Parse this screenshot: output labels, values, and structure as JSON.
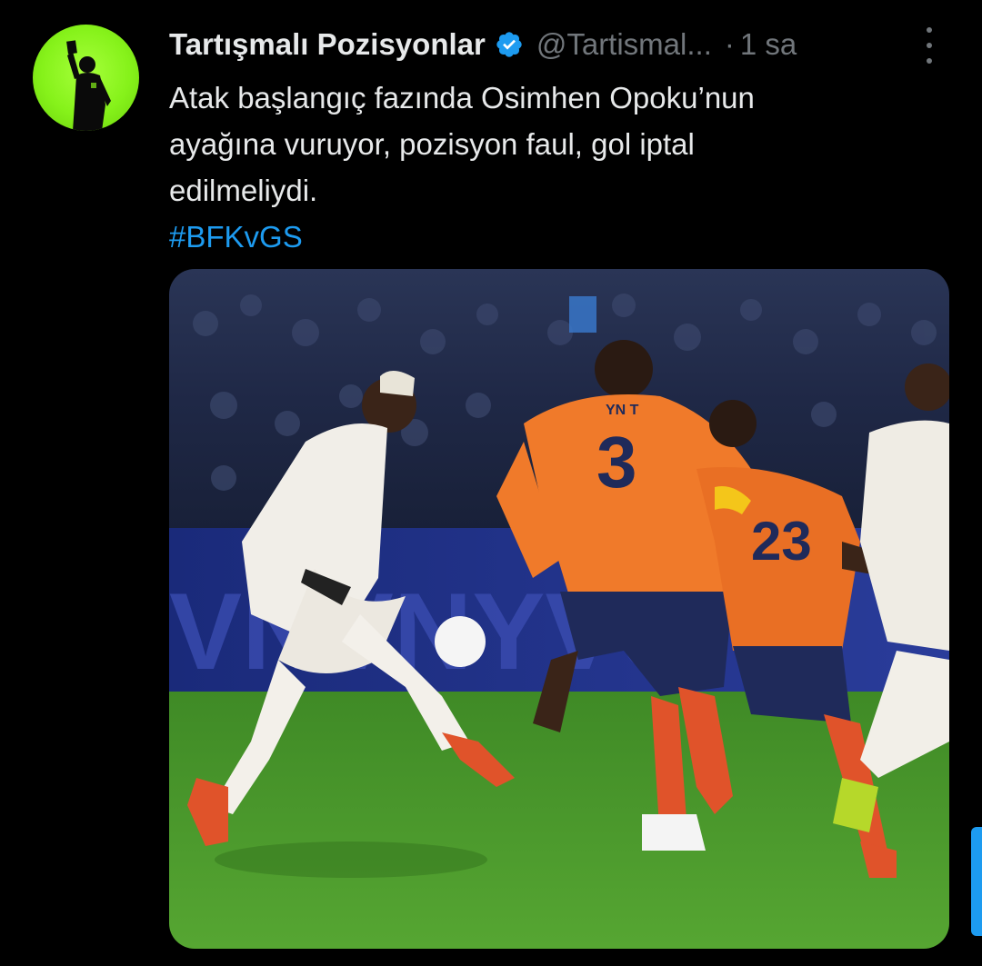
{
  "tweet": {
    "author": {
      "display_name": "Tartışmalı Pozisyonlar",
      "handle": "@Tartismal...",
      "verified": true,
      "avatar_icon": "referee-silhouette-icon"
    },
    "separator": "·",
    "time": "1 sa",
    "more_icon": "more-vertical-icon",
    "text_lines": [
      "Atak başlangıç fazında Osimhen Opoku’nun",
      "ayağına vuruyor, pozisyon faul, gol iptal",
      "edilmeliydi."
    ],
    "hashtag": "#BFKvGS",
    "media": {
      "kind": "photo",
      "jersey_numbers": [
        "3",
        "23"
      ],
      "jersey_name": "YN T"
    }
  },
  "colors": {
    "background": "#000000",
    "text_primary": "#e7e9ea",
    "text_secondary": "#71767b",
    "link": "#1d9bf0",
    "verified": "#1d9bf0",
    "avatar_green": "#86f21a",
    "jersey_orange": "#f07a2a",
    "jersey_navy": "#1f2a5a",
    "pitch_green": "#4a9a2a"
  }
}
